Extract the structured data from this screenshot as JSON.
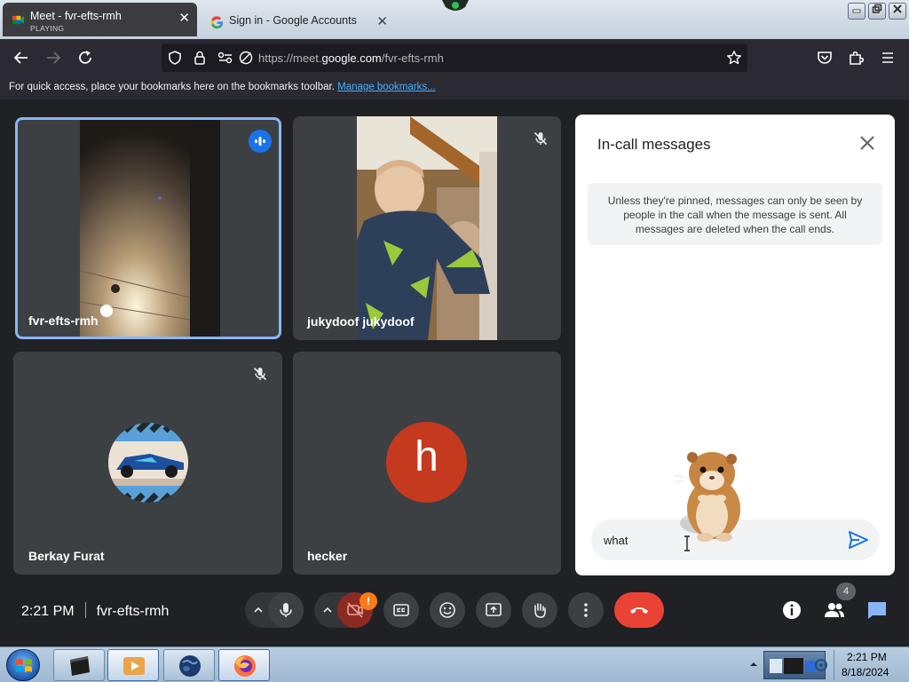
{
  "browser": {
    "tabs": [
      {
        "title": "Meet - fvr-efts-rmh",
        "status": "PLAYING",
        "close": "✕"
      },
      {
        "title": "Sign in - Google Accounts",
        "close": "✕"
      }
    ],
    "url_prefix": "https://meet.",
    "url_host": "google.com",
    "url_path": "/fvr-efts-rmh",
    "bookmarks_hint": "For quick access, place your bookmarks here on the bookmarks toolbar. ",
    "bookmarks_link": "Manage bookmarks..."
  },
  "meet": {
    "participants": [
      {
        "name": "fvr-efts-rmh",
        "state": "speaking"
      },
      {
        "name": "jukydoof jukydoof",
        "state": "muted"
      },
      {
        "name": "Berkay Furat",
        "state": "muted"
      },
      {
        "name": "hecker",
        "avatar_letter": "h",
        "avatar_color": "#c5391f"
      }
    ],
    "time": "2:21 PM",
    "meeting_code": "fvr-efts-rmh",
    "camera_alert": "!",
    "people_count": "4"
  },
  "chat": {
    "title": "In-call messages",
    "notice": "Unless they're pinned, messages can only be seen by people in the call when the message is sent. All messages are deleted when the call ends.",
    "input_value": "what"
  },
  "taskbar": {
    "time": "2:21 PM",
    "date": "8/18/2024"
  },
  "colors": {
    "accent": "#8ab4f8",
    "end_call": "#ea4335",
    "chat_send": "#1a73e8",
    "speaking_badge": "#1a73e8"
  }
}
